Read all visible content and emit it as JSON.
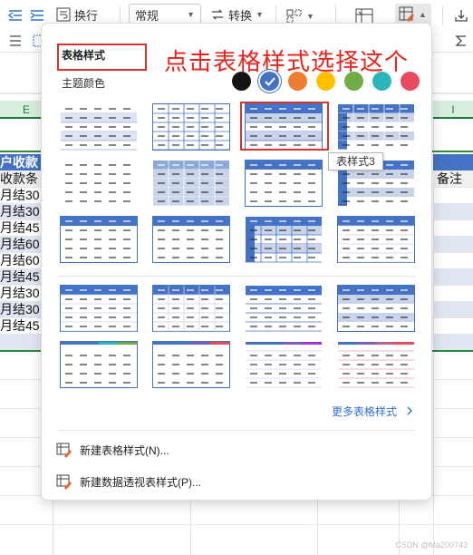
{
  "ribbon": {
    "wrap_text_label": "换行",
    "format_select_value": "常规",
    "convert_label": "转换"
  },
  "sheet": {
    "columns": [
      "E",
      "I"
    ],
    "left_cells": [
      "户收款",
      "收款条",
      "月结30",
      "月结30",
      "月结45",
      "月结60",
      "月结60",
      "月结45",
      "月结30",
      "月结30",
      "月结45"
    ],
    "right_cells": [
      "备注"
    ]
  },
  "popup": {
    "title": "表格样式",
    "theme_colors_label": "主题颜色",
    "annotation": "点击表格样式选择这个",
    "tooltip": "表样式3",
    "more_styles_link": "更多表格样式",
    "menu": {
      "new_table_style": "新建表格样式(N)...",
      "new_pivot_style": "新建数据透视表样式(P)..."
    },
    "theme_swatches": [
      {
        "name": "black",
        "color": "#141414"
      },
      {
        "name": "blue",
        "color": "#4472c4",
        "selected": true
      },
      {
        "name": "orange",
        "color": "#ed7d31"
      },
      {
        "name": "yellow",
        "color": "#ffc000"
      },
      {
        "name": "green",
        "color": "#70ad47"
      },
      {
        "name": "teal",
        "color": "#2bb5b8"
      },
      {
        "name": "red",
        "color": "#e84a5f"
      }
    ]
  },
  "watermark": "CSDN @Ma200743"
}
